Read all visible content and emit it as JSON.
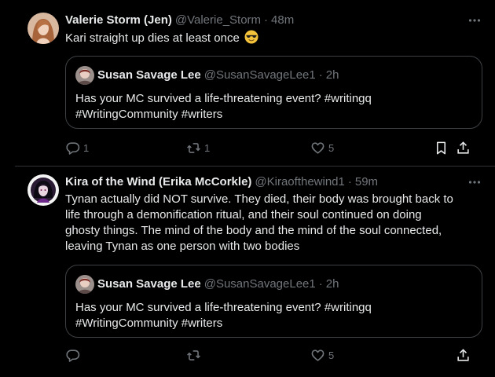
{
  "tweets": [
    {
      "display_name": "Valerie Storm (Jen)",
      "handle": "@Valerie_Storm",
      "separator": "·",
      "time": "48m",
      "text": "Kari straight up dies at least once",
      "emoji": "smiling-face-with-sunglasses",
      "quote": {
        "display_name": "Susan Savage Lee",
        "handle": "@SusanSavageLee1",
        "separator": "·",
        "time": "2h",
        "text_line1": "Has your MC survived a life-threatening event? #writingq",
        "text_line2": "#WritingCommunity #writers"
      },
      "actions": {
        "reply_count": "1",
        "retweet_count": "1",
        "like_count": "5"
      }
    },
    {
      "display_name": "Kira of the Wind (Erika McCorkle)",
      "handle": "@Kiraofthewind1",
      "separator": "·",
      "time": "59m",
      "text_lines": [
        "Tynan actually did NOT survive. They died, their body was brought back to",
        "life through a demonification ritual, and their soul continued on doing",
        "ghosty things. The mind of the body and the mind of the soul connected,",
        "leaving Tynan as one person with two bodies"
      ],
      "quote": {
        "display_name": "Susan Savage Lee",
        "handle": "@SusanSavageLee1",
        "separator": "·",
        "time": "2h",
        "text_line1": "Has your MC survived a life-threatening event? #writingq",
        "text_line2": "#WritingCommunity #writers"
      },
      "actions": {
        "reply_count": "",
        "retweet_count": "",
        "like_count": "5"
      }
    }
  ],
  "icons": {
    "reply": "reply-icon",
    "retweet": "retweet-icon",
    "like": "heart-icon",
    "bookmark": "bookmark-icon",
    "share": "share-icon",
    "more": "more-horizontal-icon"
  },
  "colors": {
    "background": "#000000",
    "text": "#e7e9ea",
    "secondary": "#71767b",
    "border": "#2f3336"
  }
}
